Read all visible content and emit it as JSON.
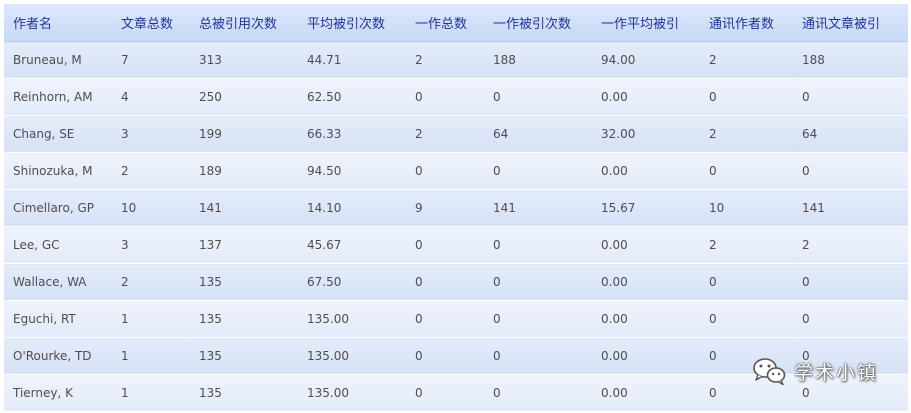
{
  "table": {
    "columns": [
      "作者名",
      "文章总数",
      "总被引用次数",
      "平均被引次数",
      "一作总数",
      "一作被引次数",
      "一作平均被引",
      "通讯作者数",
      "通讯文章被引"
    ],
    "rows": [
      [
        "Bruneau, M",
        "7",
        "313",
        "44.71",
        "2",
        "188",
        "94.00",
        "2",
        "188"
      ],
      [
        "Reinhorn, AM",
        "4",
        "250",
        "62.50",
        "0",
        "0",
        "0.00",
        "0",
        "0"
      ],
      [
        "Chang, SE",
        "3",
        "199",
        "66.33",
        "2",
        "64",
        "32.00",
        "2",
        "64"
      ],
      [
        "Shinozuka, M",
        "2",
        "189",
        "94.50",
        "0",
        "0",
        "0.00",
        "0",
        "0"
      ],
      [
        "Cimellaro, GP",
        "10",
        "141",
        "14.10",
        "9",
        "141",
        "15.67",
        "10",
        "141"
      ],
      [
        "Lee, GC",
        "3",
        "137",
        "45.67",
        "0",
        "0",
        "0.00",
        "2",
        "2"
      ],
      [
        "Wallace, WA",
        "2",
        "135",
        "67.50",
        "0",
        "0",
        "0.00",
        "0",
        "0"
      ],
      [
        "Eguchi, RT",
        "1",
        "135",
        "135.00",
        "0",
        "0",
        "0.00",
        "0",
        "0"
      ],
      [
        "O'Rourke, TD",
        "1",
        "135",
        "135.00",
        "0",
        "0",
        "0.00",
        "0",
        "0"
      ],
      [
        "Tierney, K",
        "1",
        "135",
        "135.00",
        "0",
        "0",
        "0.00",
        "0",
        "0"
      ]
    ]
  },
  "watermark": {
    "text": "学术小镇",
    "icon": "wechat-icon"
  },
  "colors": {
    "header_text": "#21349a",
    "cell_text": "#4e4e4e",
    "row_band": "#dfe7f8"
  }
}
